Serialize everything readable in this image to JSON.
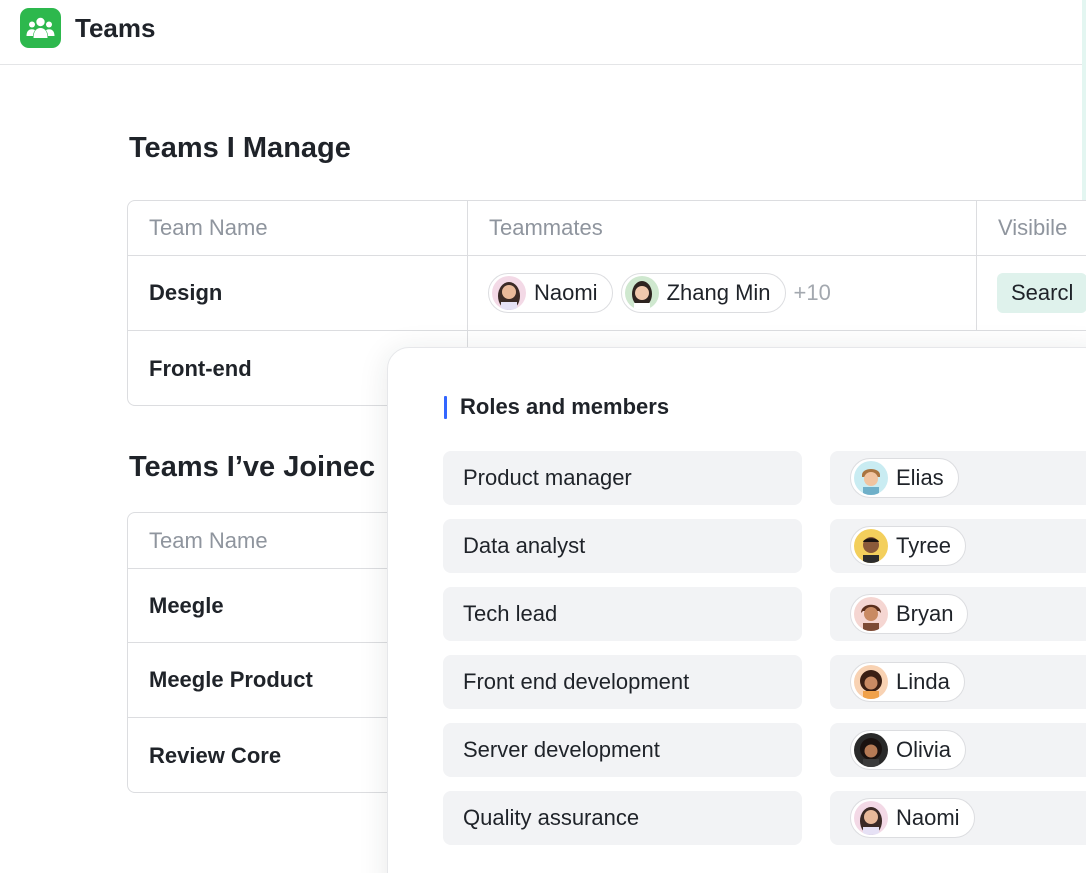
{
  "app": {
    "title": "Teams",
    "brand_color": "#2db84d",
    "icon": "team-icon"
  },
  "managed": {
    "title": "Teams I Manage",
    "columns": [
      "Team Name",
      "Teammates",
      "Visibile"
    ],
    "rows": [
      {
        "name": "Design",
        "teammates": [
          "Naomi",
          "Zhang Min"
        ],
        "more": "+10",
        "visibility": "Searcl"
      },
      {
        "name": "Front-end"
      }
    ]
  },
  "joined": {
    "title": "Teams I’ve Joinec",
    "columns": [
      "Team Name"
    ],
    "rows": [
      {
        "name": "Meegle"
      },
      {
        "name": "Meegle Product"
      },
      {
        "name": "Review Core"
      }
    ]
  },
  "roles_popup": {
    "title": "Roles and members",
    "accent": "#3366ff",
    "roles": [
      {
        "role": "Product manager",
        "member": "Elias"
      },
      {
        "role": "Data analyst",
        "member": "Tyree"
      },
      {
        "role": "Tech lead",
        "member": "Bryan"
      },
      {
        "role": "Front end development",
        "member": "Linda"
      },
      {
        "role": "Server development",
        "member": "Olivia"
      },
      {
        "role": "Quality assurance",
        "member": "Naomi"
      }
    ]
  }
}
